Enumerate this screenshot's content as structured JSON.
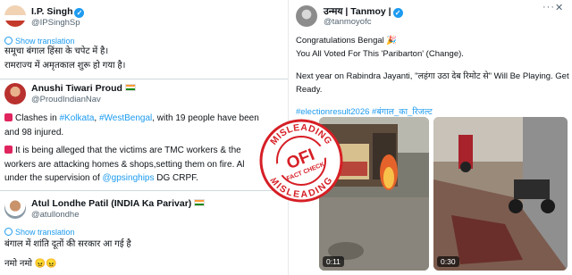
{
  "tweets_left": [
    {
      "name": "I.P. Singh",
      "handle": "@IPSinghSp",
      "show_translation": "Show translation",
      "lines": [
        "समूचा बंगाल हिंसा के चपेट में है।",
        "रामराज्य में अमृतकाल शुरू हो गया है।"
      ]
    },
    {
      "name": "Anushi Tiwari Proud",
      "handle": "@ProudIndianNav",
      "line1_pre": "Clashes in ",
      "tag1": "#Kolkata",
      "sep": ", ",
      "tag2": "#WestBengal",
      "line1_post": ", with 19 people have been",
      "line2": "and 98 injured.",
      "line3": "It is being alleged that the victims are TMC workers & the",
      "line4": "workers are attacking homes & shops,setting them on fire. Al",
      "line5_pre": "under the supervision of ",
      "mention": "@gpsinghips",
      "line5_post": " DG CRPF."
    },
    {
      "name": "Atul Londhe Patil (INDIA Ka Parivar)",
      "handle": "@atullondhe",
      "show_translation": "Show translation",
      "line1": "बंगाल में शांति दूतों की सरकार आ गई है",
      "line2": "नमो नमो 😠😠"
    }
  ],
  "tweet_right": {
    "name": "उन्मय | Tanmoy |",
    "handle": "@tanmoyofc",
    "line1": "Congratulations Bengal 🎉",
    "line2": "You All Voted For This 'Paribarton' (Change).",
    "line3": "Next year on Rabindra Jayanti, \"लहंगा उठा देब रिमोट से\" Will Be Playing. Get",
    "line4": "Ready.",
    "hashtags": "#electionresult2026 #बंगाल_का_रिजल्ट",
    "video1_time": "0:11",
    "video2_time": "0:30"
  },
  "stamp": {
    "top_text": "MISLEADING",
    "logo": "OFI",
    "sub": "FACT CHECK",
    "bottom_text": "MISLEADING"
  },
  "icons": {
    "more": "more-horizontal-icon",
    "verified": "verified-badge-icon",
    "flag": "india-flag-icon",
    "red_square": "red-square-emoji-icon"
  },
  "colors": {
    "link": "#1d9bf0",
    "stamp_red": "#d61f26",
    "text": "#0f1419",
    "muted": "#536471"
  }
}
